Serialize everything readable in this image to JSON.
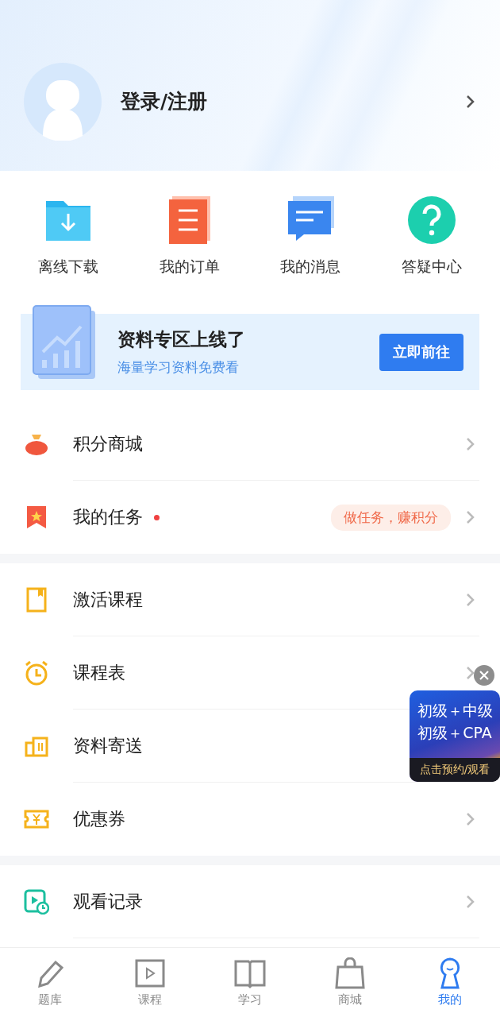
{
  "profile": {
    "login_label": "登录/注册"
  },
  "shortcuts": [
    {
      "label": "离线下载"
    },
    {
      "label": "我的订单"
    },
    {
      "label": "我的消息"
    },
    {
      "label": "答疑中心"
    }
  ],
  "banner": {
    "title": "资料专区上线了",
    "subtitle": "海量学习资料免费看",
    "button": "立即前往"
  },
  "sections": [
    [
      {
        "label": "积分商城",
        "dot": false,
        "chevron": true
      },
      {
        "label": "我的任务",
        "dot": true,
        "tag": "做任务，赚积分",
        "chevron": true
      }
    ],
    [
      {
        "label": "激活课程",
        "dot": false,
        "chevron": true
      },
      {
        "label": "课程表",
        "dot": false,
        "chevron": true
      },
      {
        "label": "资料寄送",
        "dot": false,
        "chevron": false
      },
      {
        "label": "优惠券",
        "dot": false,
        "chevron": true
      }
    ],
    [
      {
        "label": "观看记录",
        "dot": false,
        "chevron": true
      }
    ]
  ],
  "floating_ad": {
    "line_1": "初级＋中级",
    "line_2": "初级＋CPA",
    "footer": "点击预约/观看"
  },
  "tabs": [
    {
      "label": "题库",
      "selected": false
    },
    {
      "label": "课程",
      "selected": false
    },
    {
      "label": "学习",
      "selected": false
    },
    {
      "label": "商城",
      "selected": false
    },
    {
      "label": "我的",
      "selected": true
    }
  ]
}
